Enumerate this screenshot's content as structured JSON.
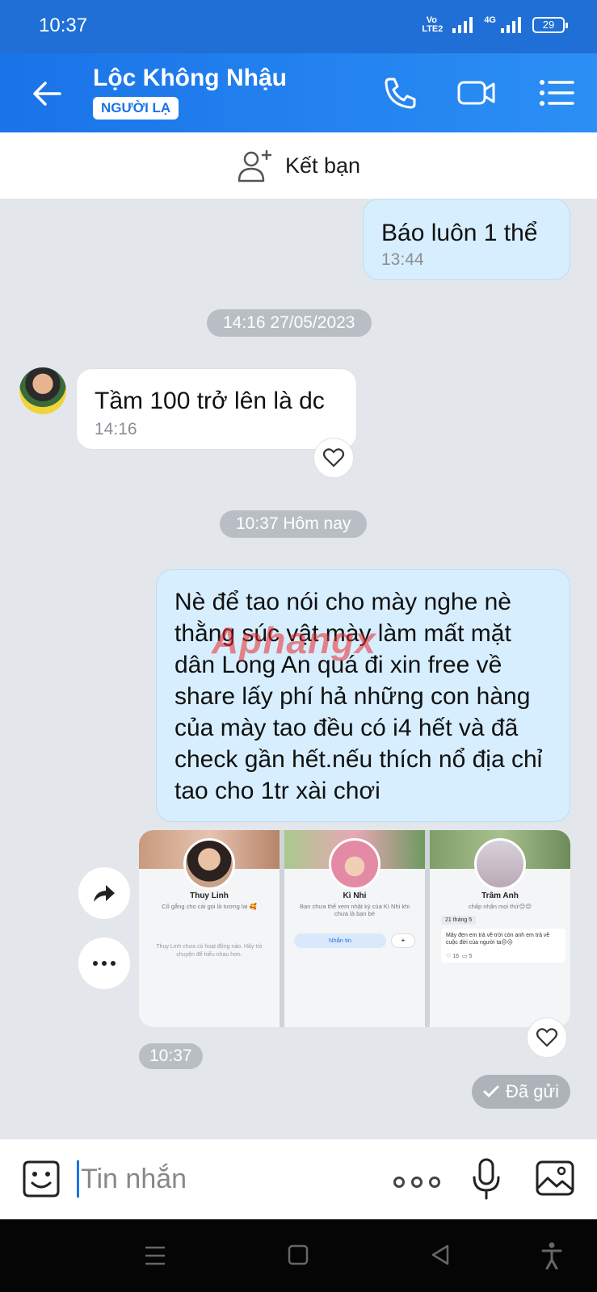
{
  "status_bar": {
    "time": "10:37",
    "volte": "Vo LTE2",
    "network": "4G",
    "battery": "29"
  },
  "header": {
    "contact_name": "Lộc Không Nhậu",
    "badge": "NGƯỜI LẠ"
  },
  "add_friend": {
    "label": "Kết bạn"
  },
  "messages": [
    {
      "from": "me",
      "text": "Báo luôn 1 thể",
      "time": "13:44"
    },
    {
      "type": "divider",
      "text": "14:16 27/05/2023"
    },
    {
      "from": "them",
      "text": "Tầm 100 trở lên là dc",
      "time": "14:16"
    },
    {
      "type": "divider",
      "text": "10:37 Hôm nay"
    },
    {
      "from": "me",
      "text": "Nè để tao nói cho mày nghe nè thằng súc vật mày làm mất mặt dân Long An quá đi xin free về share lấy phí hả những con hàng của mày tao đều có i4 hết và đã check gần hết.nếu thích nổ địa chỉ tao cho 1tr xài chơi"
    },
    {
      "from": "me",
      "type": "images",
      "time": "10:37",
      "status": "Đã gửi"
    }
  ],
  "profiles": [
    {
      "name": "Thuy Linh",
      "status": "Cố gắng cho cái gọi là tương lai 🥰",
      "body": "Thuy Linh chưa có hoạt động nào. Hãy trò chuyện để hiểu nhau hơn."
    },
    {
      "name": "Kì Nhi",
      "status": "Bạn chưa thể xem nhật ký của Kì Nhi khi chưa là bạn bè",
      "message_btn": "Nhắn tin"
    },
    {
      "name": "Trâm Anh",
      "status": "chấp nhận mọi thứ😔😔",
      "date_tag": "21 tháng 5",
      "post": "Mây đen em trả về trời còn anh em trả về cuộc đời của người ta😔😔",
      "likes": "16",
      "comments": "5"
    }
  ],
  "watermark": "Aphangx",
  "input": {
    "placeholder": "Tin nhắn"
  },
  "colors": {
    "header": "#1a73e8",
    "my_bubble": "#d7eefe",
    "background": "#e3e7ec"
  }
}
